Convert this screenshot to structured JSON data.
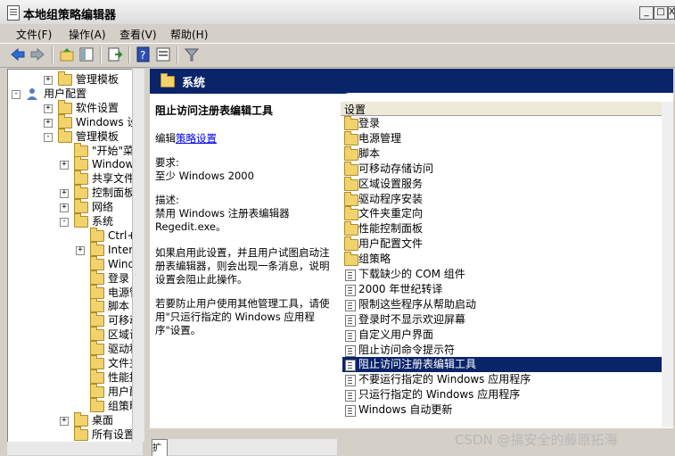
{
  "window": {
    "title": "本地组策略编辑器",
    "minimize": "_",
    "maximize": "□",
    "close": "X"
  },
  "menu": [
    "文件(F)",
    "操作(A)",
    "查看(V)",
    "帮助(H)"
  ],
  "tree": [
    {
      "label": "管理模板",
      "indent": 2,
      "exp": "+",
      "icon": "folder"
    },
    {
      "label": "用户配置",
      "indent": 0,
      "exp": "-",
      "icon": "person"
    },
    {
      "label": "软件设置",
      "indent": 2,
      "exp": "+",
      "icon": "folder"
    },
    {
      "label": "Windows 设置",
      "indent": 2,
      "exp": "+",
      "icon": "folder"
    },
    {
      "label": "管理模板",
      "indent": 2,
      "exp": "-",
      "icon": "folder"
    },
    {
      "label": "\"开始\"菜",
      "indent": 3,
      "exp": "",
      "icon": "folder"
    },
    {
      "label": "Windows 组",
      "indent": 3,
      "exp": "+",
      "icon": "folder"
    },
    {
      "label": "共享文件夹",
      "indent": 3,
      "exp": "",
      "icon": "folder"
    },
    {
      "label": "控制面板",
      "indent": 3,
      "exp": "+",
      "icon": "folder"
    },
    {
      "label": "网络",
      "indent": 3,
      "exp": "+",
      "icon": "folder"
    },
    {
      "label": "系统",
      "indent": 3,
      "exp": "-",
      "icon": "folder"
    },
    {
      "label": "Ctrl+A",
      "indent": 4,
      "exp": "",
      "icon": "folder"
    },
    {
      "label": "Intern",
      "indent": 4,
      "exp": "+",
      "icon": "folder"
    },
    {
      "label": "Window",
      "indent": 4,
      "exp": "",
      "icon": "folder"
    },
    {
      "label": "登录",
      "indent": 4,
      "exp": "",
      "icon": "folder"
    },
    {
      "label": "电源管",
      "indent": 4,
      "exp": "",
      "icon": "folder"
    },
    {
      "label": "脚本",
      "indent": 4,
      "exp": "",
      "icon": "folder"
    },
    {
      "label": "可移动",
      "indent": 4,
      "exp": "",
      "icon": "folder"
    },
    {
      "label": "区域设",
      "indent": 4,
      "exp": "",
      "icon": "folder"
    },
    {
      "label": "驱动程",
      "indent": 4,
      "exp": "",
      "icon": "folder"
    },
    {
      "label": "文件夹",
      "indent": 4,
      "exp": "",
      "icon": "folder"
    },
    {
      "label": "性能控",
      "indent": 4,
      "exp": "",
      "icon": "folder"
    },
    {
      "label": "用户配",
      "indent": 4,
      "exp": "",
      "icon": "folder"
    },
    {
      "label": "组策略",
      "indent": 4,
      "exp": "",
      "icon": "folder"
    },
    {
      "label": "桌面",
      "indent": 3,
      "exp": "+",
      "icon": "folder"
    },
    {
      "label": "所有设置",
      "indent": 3,
      "exp": "",
      "icon": "folder"
    }
  ],
  "right_header": "系统",
  "description": {
    "title": "阻止访问注册表编辑工具",
    "edit_prefix": "编辑",
    "edit_link": "策略设置",
    "req_label": "要求:",
    "req_value": "至少 Windows 2000",
    "desc_label": "描述:",
    "desc_line1": "禁用 Windows 注册表编辑器",
    "desc_line2": "Regedit.exe。",
    "para1": "如果启用此设置，并且用户试图启动注册表编辑器，则会出现一条消息，说明设置会阻止此操作。",
    "para2": "若要防止用户使用其他管理工具，请使用\"只运行指定的 Windows 应用程序\"设置。"
  },
  "list_header": "设置",
  "settings": [
    {
      "label": "登录",
      "type": "folder"
    },
    {
      "label": "电源管理",
      "type": "folder"
    },
    {
      "label": "脚本",
      "type": "folder"
    },
    {
      "label": "可移动存储访问",
      "type": "folder"
    },
    {
      "label": "区域设置服务",
      "type": "folder"
    },
    {
      "label": "驱动程序安装",
      "type": "folder"
    },
    {
      "label": "文件夹重定向",
      "type": "folder"
    },
    {
      "label": "性能控制面板",
      "type": "folder"
    },
    {
      "label": "用户配置文件",
      "type": "folder"
    },
    {
      "label": "组策略",
      "type": "folder"
    },
    {
      "label": "下载缺少的 COM 组件",
      "type": "policy"
    },
    {
      "label": "2000 年世纪转译",
      "type": "policy"
    },
    {
      "label": "限制这些程序从帮助启动",
      "type": "policy"
    },
    {
      "label": "登录时不显示欢迎屏幕",
      "type": "policy"
    },
    {
      "label": "自定义用户界面",
      "type": "policy"
    },
    {
      "label": "阻止访问命令提示符",
      "type": "policy"
    },
    {
      "label": "阻止访问注册表编辑工具",
      "type": "policy",
      "selected": true
    },
    {
      "label": "不要运行指定的 Windows 应用程序",
      "type": "policy"
    },
    {
      "label": "只运行指定的 Windows 应用程序",
      "type": "policy"
    },
    {
      "label": "Windows 自动更新",
      "type": "policy"
    }
  ],
  "tab_stub": "扩",
  "watermark": "CSDN @搞安全的藤原拓海"
}
